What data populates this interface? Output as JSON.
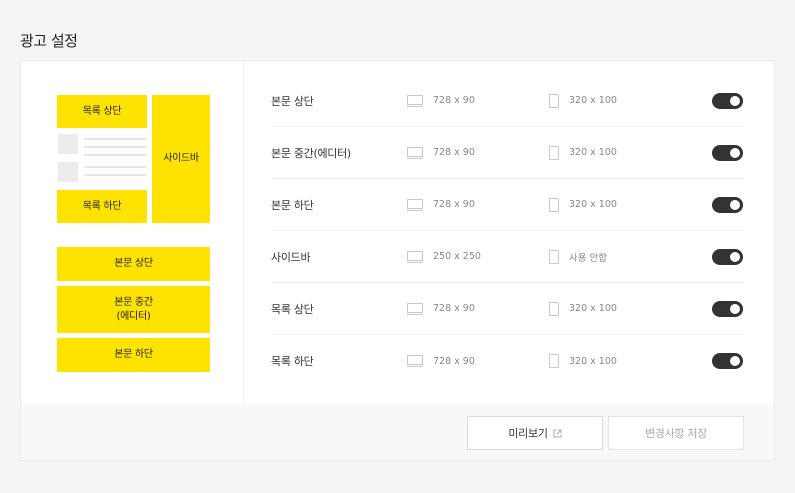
{
  "page": {
    "title": "광고 설정"
  },
  "preview": {
    "list_top": "목록 상단",
    "list_bottom": "목록 하단",
    "sidebar": "사이드바",
    "body_top": "본문 상단",
    "body_middle_line1": "본문 중간",
    "body_middle_line2": "(에디터)",
    "body_bottom": "본문 하단"
  },
  "rows": [
    {
      "label": "본문 상단",
      "pc": "728 x 90",
      "mobile": "320 x 100",
      "enabled": true
    },
    {
      "label": "본문 중간(에디터)",
      "pc": "728 x 90",
      "mobile": "320 x 100",
      "enabled": true
    },
    {
      "label": "본문 하단",
      "pc": "728 x 90",
      "mobile": "320 x 100",
      "enabled": true
    },
    {
      "label": "사이드바",
      "pc": "250 x 250",
      "mobile": "사용 안함",
      "enabled": true
    },
    {
      "label": "목록 상단",
      "pc": "728 x 90",
      "mobile": "320 x 100",
      "enabled": true
    },
    {
      "label": "목록 하단",
      "pc": "728 x 90",
      "mobile": "320 x 100",
      "enabled": true
    }
  ],
  "footer": {
    "preview_button": "미리보기",
    "save_button": "변경사항 저장"
  },
  "icons": {
    "pc": "monitor-icon",
    "mobile": "phone-icon",
    "external": "external-link-icon"
  },
  "colors": {
    "ad_slot": "#ffe300",
    "toggle_on": "#333333"
  }
}
